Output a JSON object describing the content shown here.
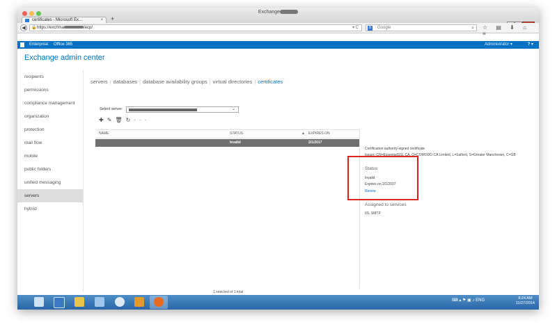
{
  "window": {
    "title": "Exchange",
    "tab_label": "certificates - Microsoft Ex...",
    "tab_close": "×",
    "new_tab": "+",
    "minimize": "–",
    "maximize": "▭",
    "close": "✕"
  },
  "address": {
    "url": "https://exchma",
    "url_suffix": "/ecp/",
    "search_placeholder": "Google"
  },
  "o365bar": {
    "enterprise": "Enterprise",
    "office365": "Office 365",
    "admin_label": "Administrator ▾",
    "help": "? ▾"
  },
  "app": {
    "title": "Exchange admin center"
  },
  "leftnav": [
    {
      "label": "recipients"
    },
    {
      "label": "permissions"
    },
    {
      "label": "compliance management"
    },
    {
      "label": "organization"
    },
    {
      "label": "protection"
    },
    {
      "label": "mail flow"
    },
    {
      "label": "mobile"
    },
    {
      "label": "public folders"
    },
    {
      "label": "unified messaging"
    },
    {
      "label": "servers",
      "selected": true
    },
    {
      "label": "hybrid"
    }
  ],
  "subtabs": [
    "servers",
    "databases",
    "database availability groups",
    "virtual directories",
    "certificates"
  ],
  "active_subtab": "certificates",
  "server_select": {
    "label": "Select server:",
    "chevron": "⌄"
  },
  "toolbar_icons": [
    "plus-icon",
    "edit-icon",
    "delete-icon",
    "refresh-icon",
    "more-icon"
  ],
  "grid": {
    "columns": {
      "name": "NAME",
      "status": "STATUS",
      "sort": "▲",
      "expires": "EXPIRES ON"
    },
    "rows": [
      {
        "name": "",
        "status": "Invalid",
        "expires": "2/1/2017"
      }
    ],
    "footer": "1 selected of 1 total"
  },
  "detail": {
    "type": "Certification authority-signed certificate",
    "issuer": "Issuer: CN=EssentialSSL CA, O=COMODO CA Limited, L=Salford, S=Greater Manchester, C=GB",
    "status_heading": "Status",
    "status_value": "Invalid",
    "expires_text": "Expires on 2/1/2017",
    "renew_link": "Renew",
    "services_heading": "Assigned to services",
    "services_value": "IIS, SMTP"
  },
  "taskbar": {
    "lang": "ENG",
    "time": "8:24 AM",
    "date": "11/27/2014"
  },
  "colors": {
    "accent": "#0072c6",
    "selected_row": "#707070",
    "highlight_box": "#d9261c",
    "taskbar": "#2a65a8"
  }
}
